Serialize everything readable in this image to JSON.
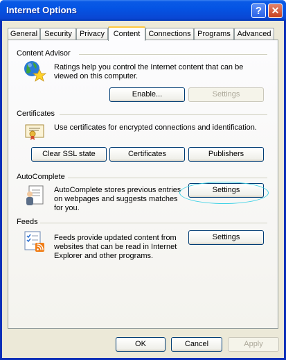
{
  "window": {
    "title": "Internet Options"
  },
  "title_buttons": {
    "help": "?",
    "close": "✕"
  },
  "tabs": [
    {
      "label": "General"
    },
    {
      "label": "Security"
    },
    {
      "label": "Privacy"
    },
    {
      "label": "Content",
      "active": true
    },
    {
      "label": "Connections"
    },
    {
      "label": "Programs"
    },
    {
      "label": "Advanced"
    }
  ],
  "content_advisor": {
    "title": "Content Advisor",
    "description": "Ratings help you control the Internet content that can be viewed on this computer.",
    "enable_button": "Enable...",
    "settings_button": "Settings"
  },
  "certificates": {
    "title": "Certificates",
    "description": "Use certificates for encrypted connections and identification.",
    "clear_ssl_button": "Clear SSL state",
    "certificates_button": "Certificates",
    "publishers_button": "Publishers"
  },
  "autocomplete": {
    "title": "AutoComplete",
    "description": "AutoComplete stores previous entries on webpages and suggests matches for you.",
    "settings_button": "Settings"
  },
  "feeds": {
    "title": "Feeds",
    "description": "Feeds provide updated content from websites that can be read in Internet Explorer and other programs.",
    "settings_button": "Settings"
  },
  "footer": {
    "ok": "OK",
    "cancel": "Cancel",
    "apply": "Apply"
  },
  "colors": {
    "title_bar": "#0454e4",
    "dialog_bg": "#ece9d8",
    "active_tab_accent": "#ffc83c",
    "highlight_ring": "#3fd2e6"
  }
}
